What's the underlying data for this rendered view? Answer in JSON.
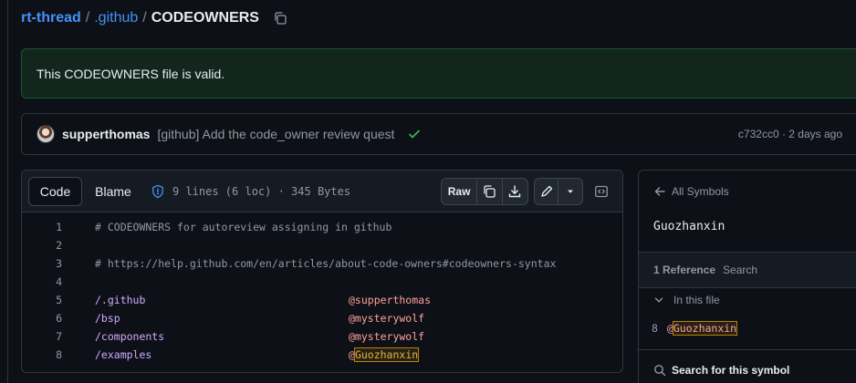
{
  "breadcrumb": {
    "repo": "rt-thread",
    "sep1": "/",
    "folder": ".github",
    "sep2": "/",
    "file": "CODEOWNERS"
  },
  "flash": {
    "message": "This CODEOWNERS file is valid."
  },
  "commit": {
    "author": "supperthomas",
    "message": "[github] Add the code_owner review quest",
    "meta": "c732cc0 · 2 days ago"
  },
  "code_header": {
    "tab_code": "Code",
    "tab_blame": "Blame",
    "file_info": "9 lines (6 loc) · 345 Bytes",
    "raw_label": "Raw"
  },
  "code_lines": [
    {
      "num": "1",
      "text": "# CODEOWNERS for autoreview assigning in github"
    },
    {
      "num": "2",
      "text": ""
    },
    {
      "num": "3",
      "text": "# https://help.github.com/en/articles/about-code-owners#codeowners-syntax"
    },
    {
      "num": "4",
      "text": ""
    },
    {
      "num": "5",
      "path": "/.github",
      "owner": "@supperthomas"
    },
    {
      "num": "6",
      "path": "/bsp",
      "owner": "@mysterywolf"
    },
    {
      "num": "7",
      "path": "/components",
      "owner": "@mysterywolf"
    },
    {
      "num": "8",
      "path": "/examples",
      "owner_prefix": "@",
      "owner_highlight": "Guozhanxin"
    }
  ],
  "symbols": {
    "back_label": "All Symbols",
    "symbol_name": "Guozhanxin",
    "reference_count": "1 Reference",
    "search_label": "Search",
    "in_file_label": "In this file",
    "ref_line_num": "8",
    "ref_prefix": "@",
    "ref_text": "Guozhanxin",
    "search_symbol_label": "Search for this symbol"
  },
  "colors": {
    "link": "#4493f8",
    "success_bg": "#12261e",
    "check": "#3fb950",
    "owner": "#ffa198",
    "path": "#d2a8ff",
    "highlight": "#bb8009"
  }
}
